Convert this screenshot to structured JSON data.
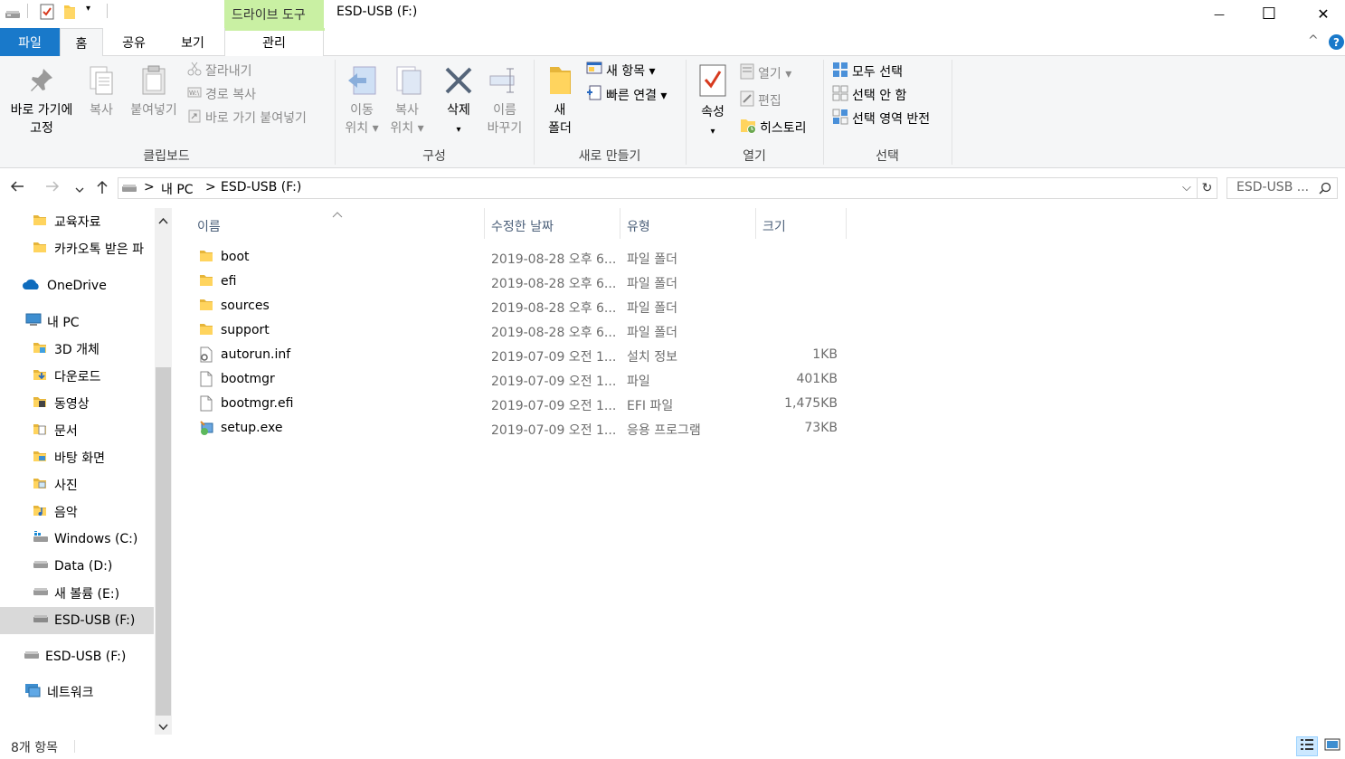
{
  "window": {
    "context_tab_header": "드라이브 도구",
    "title": "ESD-USB (F:)",
    "minimize_glyph": "—",
    "maximize_glyph": "☐",
    "close_glyph": "✕"
  },
  "tabs": {
    "file": "파일",
    "home": "홈",
    "share": "공유",
    "view": "보기",
    "manage": "관리",
    "collapse_glyph": "^",
    "help_glyph": "?"
  },
  "ribbon": {
    "clipboard": {
      "label": "클립보드",
      "pin_line1": "바로 가기에",
      "pin_line2": "고정",
      "copy": "복사",
      "paste": "붙여넣기",
      "cut": "잘라내기",
      "copy_path": "경로 복사",
      "paste_shortcut": "바로 가기 붙여넣기"
    },
    "organize": {
      "label": "구성",
      "move_line1": "이동",
      "move_line2": "위치 ▾",
      "copyto_line1": "복사",
      "copyto_line2": "위치 ▾",
      "delete": "삭제",
      "delete_arrow": "▾",
      "rename_line1": "이름",
      "rename_line2": "바꾸기"
    },
    "new": {
      "label": "새로 만들기",
      "folder_line1": "새",
      "folder_line2": "폴더",
      "new_item": "새 항목 ▾",
      "easy_access": "빠른 연결 ▾"
    },
    "open": {
      "label": "열기",
      "properties": "속성",
      "properties_arrow": "▾",
      "open": "열기 ▾",
      "edit": "편집",
      "history": "히스토리"
    },
    "select": {
      "label": "선택",
      "select_all": "모두 선택",
      "select_none": "선택 안 함",
      "invert": "선택 영역 반전"
    }
  },
  "address": {
    "path": [
      ">",
      "내 PC",
      ">",
      "ESD-USB (F:)"
    ],
    "search_placeholder": "ESD-USB ...",
    "dropdown_glyph": "⌵",
    "refresh_glyph": "↻"
  },
  "nav": {
    "items": [
      {
        "label": "교육자료",
        "icon": "folder-icon"
      },
      {
        "label": "카카오톡 받은 파",
        "icon": "folder-icon"
      },
      {
        "label": "OneDrive",
        "icon": "cloud-icon"
      },
      {
        "label": "내 PC",
        "icon": "pc-icon"
      },
      {
        "label": "3D 개체",
        "icon": "3d-objects-icon"
      },
      {
        "label": "다운로드",
        "icon": "download-icon"
      },
      {
        "label": "동영상",
        "icon": "video-icon"
      },
      {
        "label": "문서",
        "icon": "document-icon"
      },
      {
        "label": "바탕 화면",
        "icon": "desktop-icon"
      },
      {
        "label": "사진",
        "icon": "pictures-icon"
      },
      {
        "label": "음악",
        "icon": "music-icon"
      },
      {
        "label": "Windows (C:)",
        "icon": "windows-drive-icon"
      },
      {
        "label": "Data (D:)",
        "icon": "drive-icon"
      },
      {
        "label": "새 볼륨 (E:)",
        "icon": "drive-icon"
      },
      {
        "label": "ESD-USB (F:)",
        "icon": "usb-drive-icon"
      },
      {
        "label": "ESD-USB (F:)",
        "icon": "usb-drive-icon"
      },
      {
        "label": "네트워크",
        "icon": "network-icon"
      }
    ]
  },
  "columns": {
    "name": "이름",
    "date": "수정한 날짜",
    "type": "유형",
    "size": "크기"
  },
  "files": [
    {
      "name": "boot",
      "date": "2019-08-28 오후 6...",
      "type": "파일 폴더",
      "size": "",
      "icon": "folder-icon"
    },
    {
      "name": "efi",
      "date": "2019-08-28 오후 6...",
      "type": "파일 폴더",
      "size": "",
      "icon": "folder-icon"
    },
    {
      "name": "sources",
      "date": "2019-08-28 오후 6...",
      "type": "파일 폴더",
      "size": "",
      "icon": "folder-icon"
    },
    {
      "name": "support",
      "date": "2019-08-28 오후 6...",
      "type": "파일 폴더",
      "size": "",
      "icon": "folder-icon"
    },
    {
      "name": "autorun.inf",
      "date": "2019-07-09 오전 1...",
      "type": "설치 정보",
      "size": "1KB",
      "icon": "settings-file-icon"
    },
    {
      "name": "bootmgr",
      "date": "2019-07-09 오전 1...",
      "type": "파일",
      "size": "401KB",
      "icon": "file-icon"
    },
    {
      "name": "bootmgr.efi",
      "date": "2019-07-09 오전 1...",
      "type": "EFI 파일",
      "size": "1,475KB",
      "icon": "file-icon"
    },
    {
      "name": "setup.exe",
      "date": "2019-07-09 오전 1...",
      "type": "응용 프로그램",
      "size": "73KB",
      "icon": "setup-exe-icon"
    }
  ],
  "status": {
    "count": "8개 항목"
  },
  "colors": {
    "file_tab": "#1979ca",
    "context_tab": "#c9f0a3",
    "selection": "#d9d9d9",
    "ribbon_bg": "#f5f6f7"
  }
}
